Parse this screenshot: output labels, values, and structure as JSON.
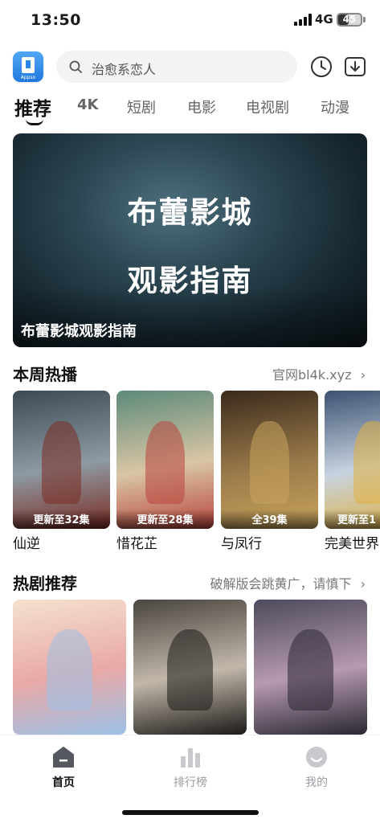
{
  "status_bar": {
    "time": "13:50",
    "network": "4G",
    "battery": "45",
    "battery_level": 0.45
  },
  "header": {
    "logo_text": "Appso",
    "search_placeholder": "治愈系恋人",
    "history_icon": "clock-icon",
    "download_icon": "download-icon"
  },
  "tabs": [
    {
      "label": "推荐",
      "active": true
    },
    {
      "label": "4K"
    },
    {
      "label": "短剧"
    },
    {
      "label": "电影"
    },
    {
      "label": "电视剧"
    },
    {
      "label": "动漫"
    }
  ],
  "banner": {
    "line1": "布蕾影城",
    "line2": "观影指南",
    "caption": "布蕾影城观影指南"
  },
  "weekly_hot": {
    "title": "本周热播",
    "link": "官网bl4k.xyz",
    "link_icon": "chevron-right-icon",
    "items": [
      {
        "title": "仙逆",
        "episodes": "更新至32集",
        "colors": [
          "#3b4a55",
          "#8e9aa3",
          "#7a2b22"
        ]
      },
      {
        "title": "惜花芷",
        "episodes": "更新至28集",
        "colors": [
          "#5d8a7a",
          "#d9c6a5",
          "#b8443c"
        ]
      },
      {
        "title": "与凤行",
        "episodes": "全39集",
        "colors": [
          "#3a2a1c",
          "#9a7a4a",
          "#c9a45c"
        ]
      },
      {
        "title": "完美世界",
        "episodes": "更新至1",
        "colors": [
          "#3d5272",
          "#c7d3e0",
          "#e0b040"
        ]
      }
    ]
  },
  "hot_drama": {
    "title": "热剧推荐",
    "link": "破解版会跳黄广，请慎下",
    "link_icon": "chevron-right-icon",
    "items": [
      {
        "colors": [
          "#f4e1d0",
          "#e9a9a6",
          "#9cc0e6"
        ]
      },
      {
        "colors": [
          "#4a4540",
          "#c2b8aa",
          "#1c1a18"
        ]
      },
      {
        "colors": [
          "#4d4a5c",
          "#b69ab0",
          "#2a2733"
        ]
      }
    ]
  },
  "bottom_nav": [
    {
      "label": "首页",
      "icon": "home-icon",
      "active": true
    },
    {
      "label": "排行榜",
      "icon": "bar-chart-icon"
    },
    {
      "label": "我的",
      "icon": "profile-icon"
    }
  ],
  "colors": {
    "accent": "#111111",
    "inactive": "#9a9ca1",
    "search_bg": "#f2f3f5"
  }
}
